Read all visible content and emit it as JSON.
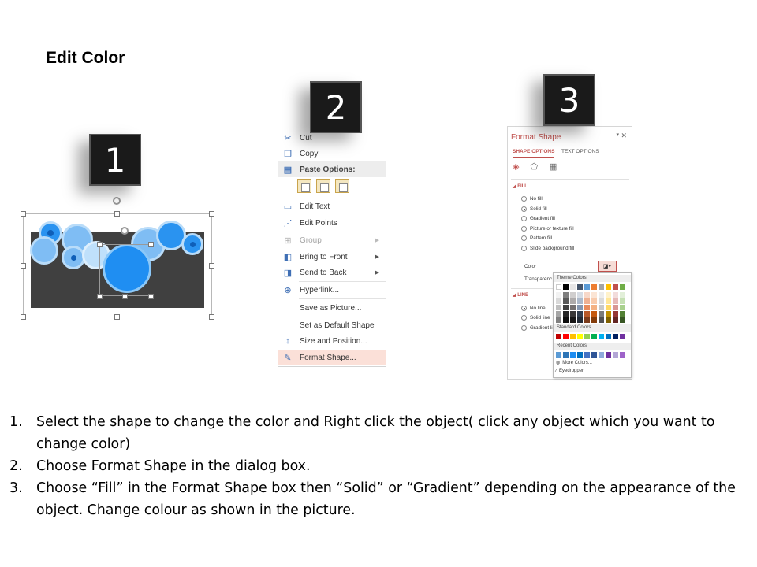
{
  "title": "Edit Color",
  "steps": {
    "badge_1": "1",
    "badge_2": "2",
    "badge_3": "3"
  },
  "context_menu": {
    "items": [
      {
        "label": "Cut",
        "icon": "scissors-icon"
      },
      {
        "label": "Copy",
        "icon": "copy-icon"
      },
      {
        "label": "Paste Options:",
        "icon": "clipboard-icon"
      },
      {
        "label": "Edit Text",
        "icon": "edit-text-icon"
      },
      {
        "label": "Edit Points",
        "icon": "edit-points-icon"
      },
      {
        "label": "Group",
        "icon": "group-icon"
      },
      {
        "label": "Bring to Front",
        "icon": "bring-front-icon"
      },
      {
        "label": "Send to Back",
        "icon": "send-back-icon"
      },
      {
        "label": "Hyperlink...",
        "icon": "hyperlink-icon"
      },
      {
        "label": "Save as Picture...",
        "icon": ""
      },
      {
        "label": "Set as Default Shape",
        "icon": ""
      },
      {
        "label": "Size and Position...",
        "icon": "size-position-icon"
      },
      {
        "label": "Format Shape...",
        "icon": "format-shape-icon"
      }
    ]
  },
  "format_shape": {
    "title": "Format Shape",
    "tab_shape": "SHAPE OPTIONS",
    "tab_text": "TEXT OPTIONS",
    "fill_section": "FILL",
    "fill_options": [
      "No fill",
      "Solid fill",
      "Gradient fill",
      "Picture or texture fill",
      "Pattern fill",
      "Slide background fill"
    ],
    "fill_selected": "Solid fill",
    "color_label": "Color",
    "transparency_label": "Transparenc",
    "line_section": "LINE",
    "line_options": [
      "No line",
      "Solid line",
      "Gradient li"
    ],
    "line_selected": "No line"
  },
  "palette": {
    "theme_colors_label": "Theme Colors",
    "standard_colors_label": "Standard Colors",
    "recent_colors_label": "Recent Colors",
    "more_colors": "More Colors...",
    "eyedropper": "Eyedropper",
    "theme_top": [
      "#ffffff",
      "#000000",
      "#e7e6e6",
      "#44546a",
      "#5b9bd5",
      "#ed7d31",
      "#a5a5a5",
      "#ffc000",
      "#c0504d",
      "#70ad47"
    ],
    "theme_columns": [
      [
        "#f2f2f2",
        "#d9d9d9",
        "#bfbfbf",
        "#a6a6a6",
        "#808080"
      ],
      [
        "#7f7f7f",
        "#595959",
        "#404040",
        "#262626",
        "#0d0d0d"
      ],
      [
        "#d0cece",
        "#aeabab",
        "#757171",
        "#3a3838",
        "#171616"
      ],
      [
        "#d6dce4",
        "#adb9ca",
        "#8496b0",
        "#333f4f",
        "#222a35"
      ],
      [
        "#f7d8c9",
        "#efb193",
        "#e88b5d",
        "#b95a2a",
        "#7b3c1c"
      ],
      [
        "#fbe5d5",
        "#f8cbad",
        "#f4b183",
        "#c55a11",
        "#833c0b"
      ],
      [
        "#ededed",
        "#dbdbdb",
        "#c9c9c9",
        "#7b7b7b",
        "#525252"
      ],
      [
        "#fff2cc",
        "#ffe699",
        "#ffd966",
        "#bf8f00",
        "#7f6000"
      ],
      [
        "#f2dcdb",
        "#e6b9b8",
        "#d99694",
        "#953735",
        "#632523"
      ],
      [
        "#e2efd9",
        "#c5e0b3",
        "#a8d08d",
        "#538135",
        "#375623"
      ]
    ],
    "standard": [
      "#c00000",
      "#ff0000",
      "#ffc000",
      "#ffff00",
      "#92d050",
      "#00b050",
      "#00b0f0",
      "#0070c0",
      "#002060",
      "#7030a0"
    ],
    "recent": [
      "#5b9bd5",
      "#2e75b6",
      "#1f8ef2",
      "#0070c0",
      "#4472c4",
      "#2f5597",
      "#8faadc",
      "#7030a0",
      "#b4a7d6",
      "#9e63c9"
    ]
  },
  "instructions": [
    {
      "num": "1.",
      "text": "Select the shape to change the color and Right click the object( click any object which you want to change color)"
    },
    {
      "num": "2.",
      "text": "Choose Format Shape in the dialog box."
    },
    {
      "num": "3.",
      "text": "Choose “Fill” in the Format Shape box then “Solid” or “Gradient” depending on the appearance of the object. Change colour as shown in the picture."
    }
  ],
  "colors": {
    "accent": "#c0504d",
    "circle_blue": "#1f8ef2",
    "dark_rect": "#404040"
  }
}
